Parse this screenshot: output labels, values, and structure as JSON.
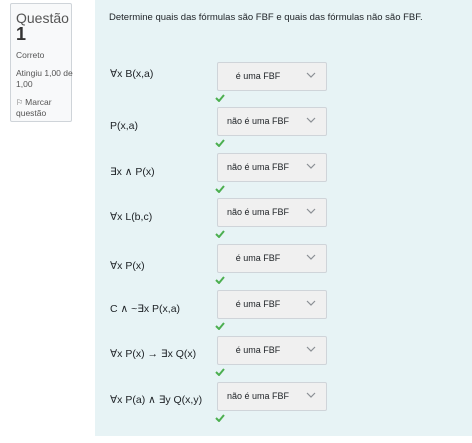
{
  "question": {
    "label": "Questão",
    "number": "1",
    "state": "Correto",
    "grade": "Atingiu 1,00 de 1,00",
    "flag": "Marcar questão"
  },
  "prompt": "Determine quais das fórmulas são FBF e quais das fórmulas não são FBF.",
  "icons": {
    "flag": "flag-icon",
    "chevron": "chevron-down-icon",
    "check": "check-icon"
  },
  "colors": {
    "check": "#4caf50",
    "panel": "#e7f3f5"
  },
  "rows": [
    {
      "formula": "∀x B(x,a)",
      "answer": "é uma FBF"
    },
    {
      "formula": "P(x,a)",
      "answer": "não é uma FBF"
    },
    {
      "formula": "∃x ∧ P(x)",
      "answer": "não é uma FBF"
    },
    {
      "formula": "∀x L(b,c)",
      "answer": "não é uma FBF"
    },
    {
      "formula": "∀x P(x)",
      "answer": "é uma FBF"
    },
    {
      "formula": "C ∧ ~∃x P(x,a)",
      "answer": "é uma FBF"
    },
    {
      "formula": "∀x P(x) → ∃x Q(x)",
      "answer": "é uma FBF"
    },
    {
      "formula": "∀x P(a) ∧ ∃y Q(x,y)",
      "answer": "não é uma FBF"
    }
  ]
}
